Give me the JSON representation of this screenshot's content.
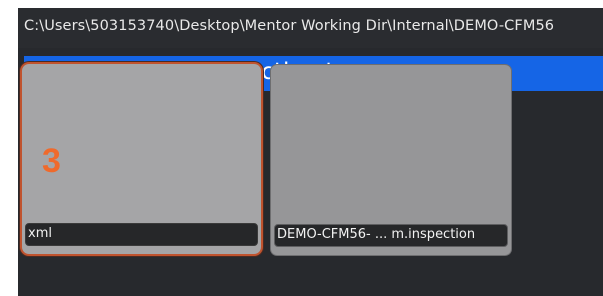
{
  "path_bar": {
    "path": "C:\\Users\\503153740\\Desktop\\Mentor Working Dir\\Internal\\DEMO-CFM56"
  },
  "dialog": {
    "title": "Select second inspection to merge"
  },
  "inspections": [
    {
      "number": "3",
      "label": "xml",
      "selected": true
    },
    {
      "label": "DEMO-CFM56- ... m.inspection",
      "selected": false
    }
  ],
  "colors": {
    "background": "#27292d",
    "banner": "#1565e6",
    "selection_border": "#c0532e",
    "number": "#ef6a2c"
  }
}
